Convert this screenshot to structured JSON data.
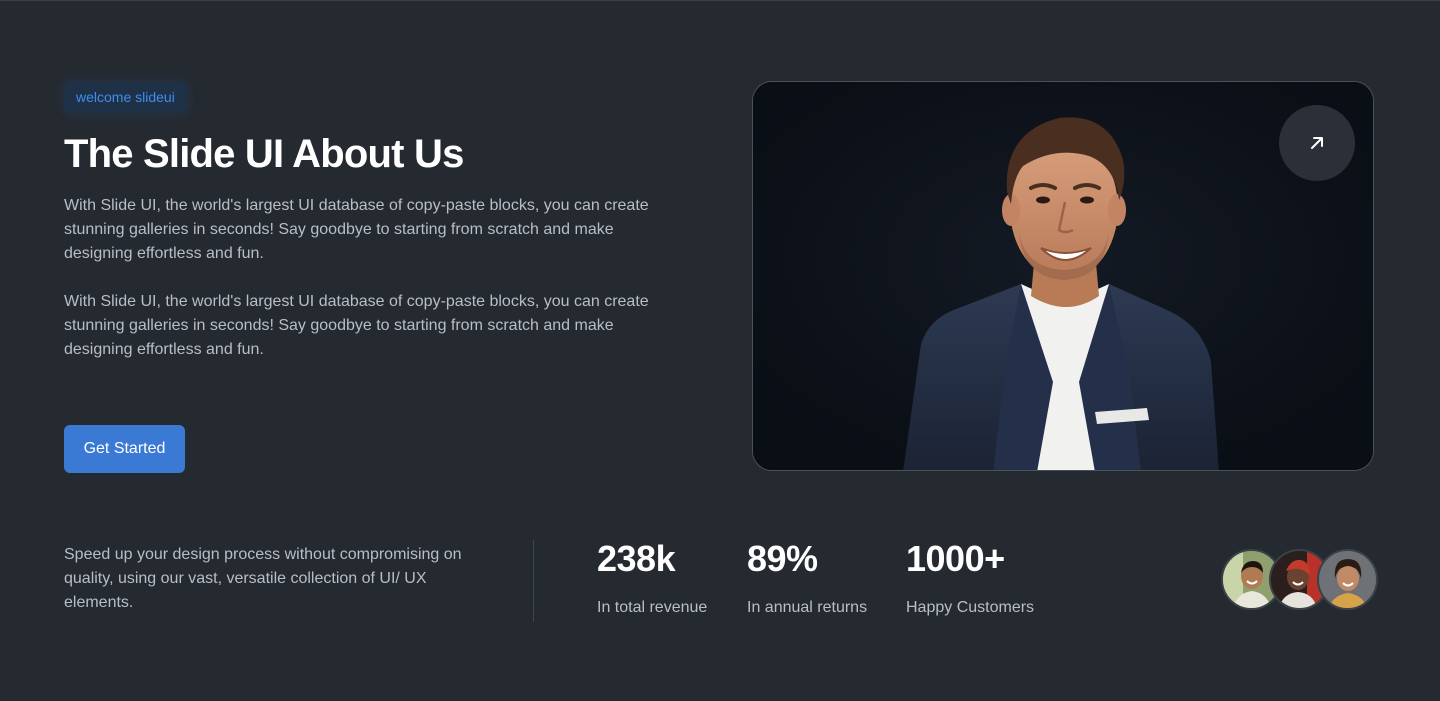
{
  "hero": {
    "badge": "welcome slideui",
    "title": "The Slide UI About Us",
    "paragraphs": [
      "With Slide UI, the world's largest UI database of copy-paste blocks, you can create stunning galleries in seconds! Say goodbye to starting from scratch and make designing effortless and fun.",
      "With Slide UI, the world's largest UI database of copy-paste blocks, you can create stunning galleries in seconds! Say goodbye to starting from scratch and make designing effortless and fun."
    ],
    "cta_label": "Get Started",
    "arrow_icon": "arrow-up-right-icon",
    "photo": "businessman-portrait"
  },
  "stats": {
    "description": "Speed up your design process without compromising on quality, using our vast, versatile collection of UI/ UX elements.",
    "items": [
      {
        "value": "238k",
        "label": "In total revenue"
      },
      {
        "value": "89%",
        "label": "In annual returns"
      },
      {
        "value": "1000+",
        "label": "Happy Customers"
      }
    ],
    "avatars": [
      "customer-avatar",
      "customer-avatar",
      "customer-avatar"
    ]
  },
  "colors": {
    "background": "#252a31",
    "accent": "#3a79d4",
    "badge_text": "#3f8cf0",
    "body_text": "#b8bec8",
    "card": "#0c1018"
  }
}
